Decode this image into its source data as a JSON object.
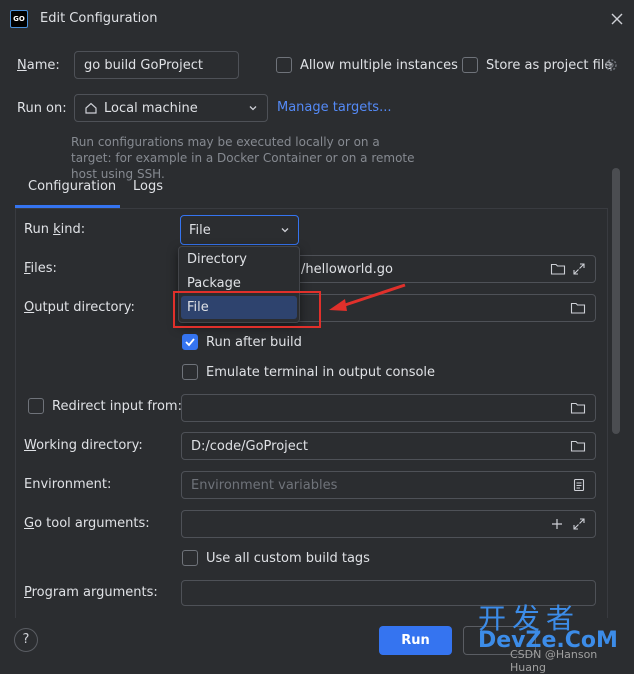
{
  "window": {
    "title": "Edit Configuration",
    "app_icon_text": "GO"
  },
  "form": {
    "name_label": "Name:",
    "name_value": "go build GoProject",
    "allow_multiple_label": "Allow multiple instances",
    "store_project_label": "Store as project file",
    "run_on_label": "Run on:",
    "run_on_value": "Local machine",
    "manage_targets": "Manage targets...",
    "hint": "Run configurations may be executed locally or on a target: for example in a Docker Container or on a remote host using SSH."
  },
  "tabs": [
    {
      "label": "Configuration"
    },
    {
      "label": "Logs"
    }
  ],
  "config": {
    "run_kind_label": "Run kind:",
    "run_kind_value": "File",
    "files_label": "Files:",
    "files_value": "/helloworld.go",
    "output_dir_label": "Output directory:",
    "run_after_build_label": "Run after build",
    "emulate_terminal_label": "Emulate terminal in output console",
    "redirect_input_label": "Redirect input from:",
    "working_dir_label": "Working directory:",
    "working_dir_value": "D:/code/GoProject",
    "environment_label": "Environment:",
    "environment_placeholder": "Environment variables",
    "go_tool_args_label": "Go tool arguments:",
    "custom_build_tags_label": "Use all custom build tags",
    "program_args_label": "Program arguments:"
  },
  "dropdown_options": [
    "Directory",
    "Package",
    "File"
  ],
  "buttons": {
    "run": "Run",
    "help": "?"
  },
  "watermark": {
    "big": "开发者",
    "logo": "DevZe.CoM",
    "small": "CSDN @Hanson Huang"
  },
  "colors": {
    "accent": "#3574f0",
    "annotation": "#e0302b"
  }
}
